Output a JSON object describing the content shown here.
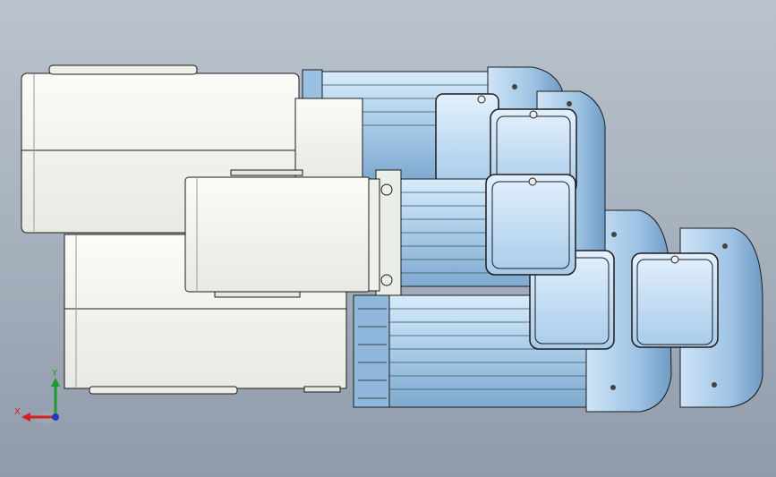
{
  "viewport": {
    "background_top": "#b9c2cd",
    "background_bottom": "#8f9bab"
  },
  "model": {
    "gearbox_color": "#f4f4ef",
    "motor_color": "#a9cbe9",
    "motor_shade": "#7fa9cf",
    "edge_color": "#1c1c1c",
    "screw_icon": "screw-icon"
  },
  "triad": {
    "x_label": "X",
    "y_label": "Y",
    "x_color": "#d61f1f",
    "y_color": "#1a9b2a",
    "z_color": "#1f38c9"
  }
}
